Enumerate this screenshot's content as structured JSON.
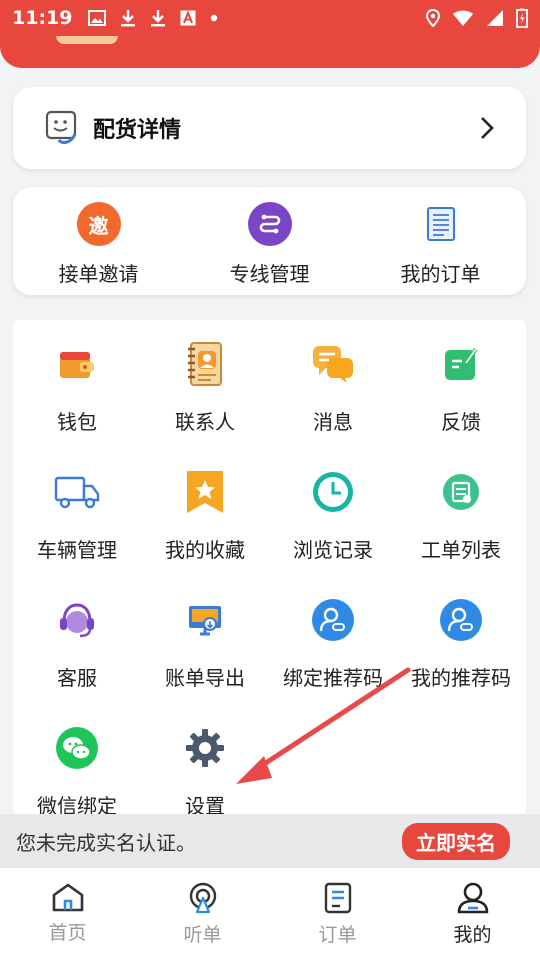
{
  "status_bar": {
    "time": "11:19"
  },
  "dispatch": {
    "title": "配货详情"
  },
  "quick_actions": [
    {
      "label": "接单邀请",
      "icon": "invite-icon",
      "icon_text": "邀",
      "color": "#f2692e"
    },
    {
      "label": "专线管理",
      "icon": "route-icon",
      "color": "#7b46c6"
    },
    {
      "label": "我的订单",
      "icon": "order-list-icon",
      "color": "#3a7bd5"
    }
  ],
  "grid_items": [
    {
      "label": "钱包",
      "icon": "wallet-icon"
    },
    {
      "label": "联系人",
      "icon": "contacts-icon"
    },
    {
      "label": "消息",
      "icon": "message-icon"
    },
    {
      "label": "反馈",
      "icon": "feedback-icon"
    },
    {
      "label": "车辆管理",
      "icon": "truck-icon"
    },
    {
      "label": "我的收藏",
      "icon": "favorite-icon"
    },
    {
      "label": "浏览记录",
      "icon": "history-clock-icon"
    },
    {
      "label": "工单列表",
      "icon": "work-order-icon"
    },
    {
      "label": "客服",
      "icon": "customer-service-icon"
    },
    {
      "label": "账单导出",
      "icon": "bill-export-icon"
    },
    {
      "label": "绑定推荐码",
      "icon": "bind-referral-icon"
    },
    {
      "label": "我的推荐码",
      "icon": "my-referral-icon"
    },
    {
      "label": "微信绑定",
      "icon": "wechat-icon"
    },
    {
      "label": "设置",
      "icon": "settings-gear-icon"
    }
  ],
  "banner": {
    "text": "您未完成实名认证。",
    "button": "立即实名"
  },
  "tabs": [
    {
      "label": "首页",
      "icon": "home-icon",
      "active": false
    },
    {
      "label": "听单",
      "icon": "listen-order-icon",
      "active": false
    },
    {
      "label": "订单",
      "icon": "order-icon",
      "active": false
    },
    {
      "label": "我的",
      "icon": "profile-icon",
      "active": true
    }
  ],
  "colors": {
    "brand_red": "#e8473d",
    "accent_blue": "#2f8ae6"
  }
}
